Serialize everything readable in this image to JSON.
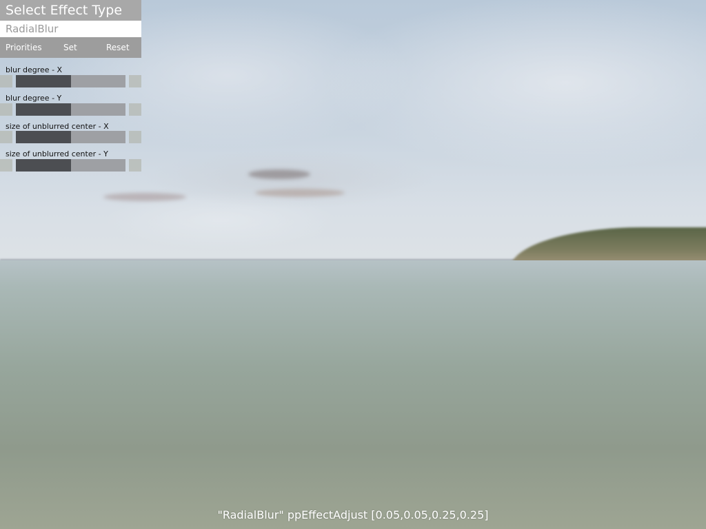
{
  "panel": {
    "title": "Select Effect Type",
    "effect_value": "RadialBlur",
    "buttons": {
      "priorities": "Priorities",
      "set": "Set",
      "reset": "Reset"
    },
    "params": [
      {
        "label": "blur degree - X",
        "value_fraction": 0.5
      },
      {
        "label": "blur degree - Y",
        "value_fraction": 0.5
      },
      {
        "label": "size of unblurred center - X",
        "value_fraction": 0.5
      },
      {
        "label": "size of unblurred center - Y",
        "value_fraction": 0.5
      }
    ]
  },
  "status": {
    "command": "\"RadialBlur\" ppEffectAdjust [0.05,0.05,0.25,0.25]"
  },
  "colors": {
    "panel_header": "#a8a8a8",
    "button_bar": "#9d9d9d",
    "slider_fill": "#4c4e52",
    "slider_track": "#9ea0a4"
  }
}
